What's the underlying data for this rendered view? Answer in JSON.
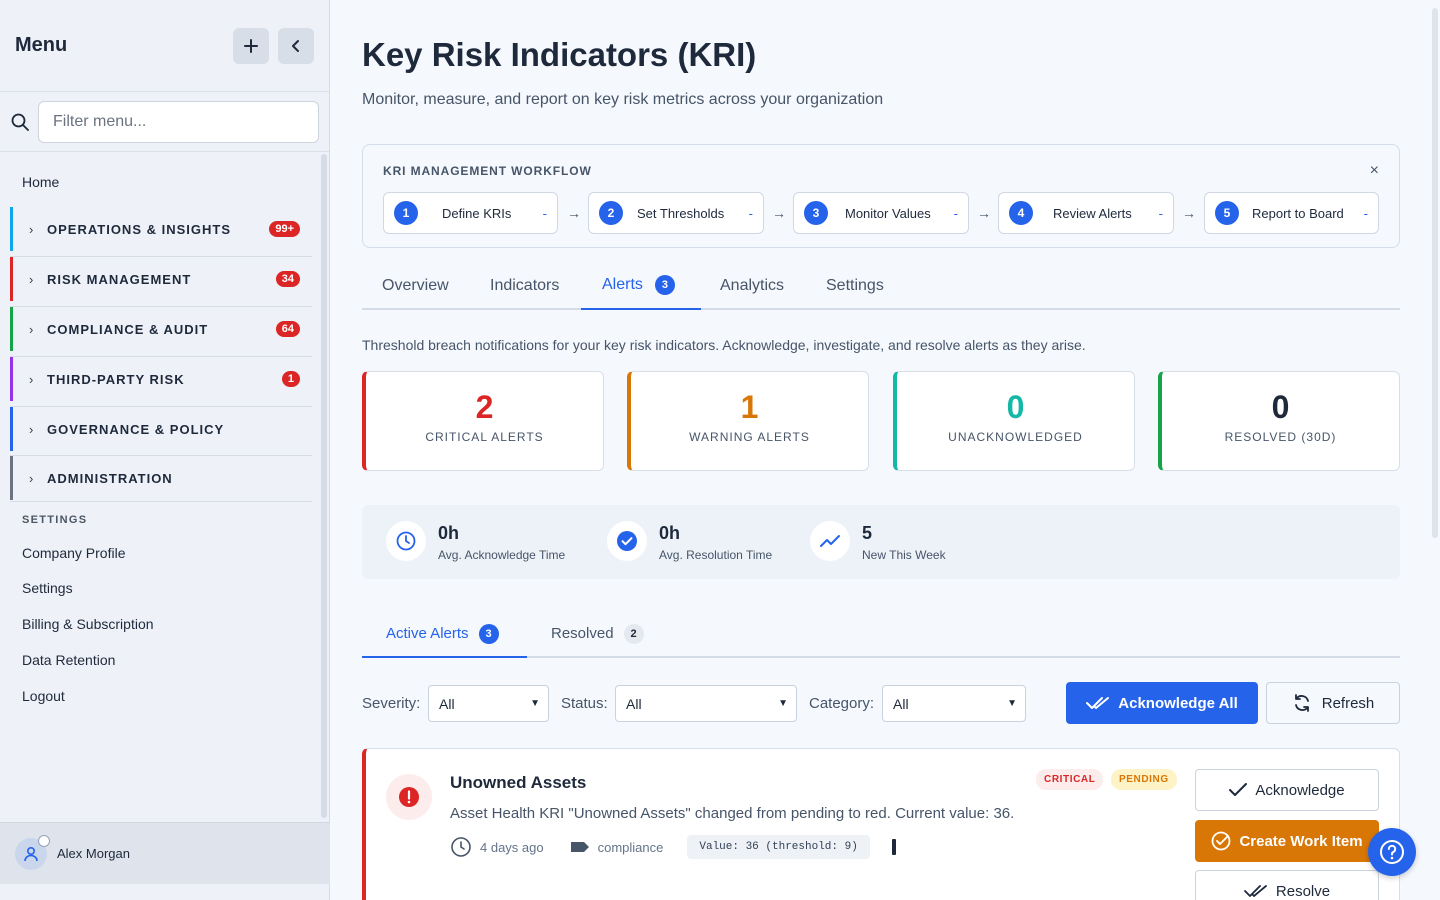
{
  "sidebar": {
    "title": "Menu",
    "filter_placeholder": "Filter menu...",
    "home": "Home",
    "groups": [
      {
        "label": "OPERATIONS & INSIGHTS",
        "badge": "99+",
        "color": "#0ea5e9"
      },
      {
        "label": "RISK MANAGEMENT",
        "badge": "34",
        "color": "#dc2626"
      },
      {
        "label": "COMPLIANCE & AUDIT",
        "badge": "64",
        "color": "#16a34a"
      },
      {
        "label": "THIRD-PARTY RISK",
        "badge": "1",
        "color": "#9333ea"
      },
      {
        "label": "GOVERNANCE & POLICY",
        "badge": "",
        "color": "#2563eb"
      },
      {
        "label": "ADMINISTRATION",
        "badge": "",
        "color": "#6b7280"
      }
    ],
    "settings_section": "SETTINGS",
    "links": [
      "Company Profile",
      "Settings",
      "Billing & Subscription",
      "Data Retention",
      "Logout"
    ],
    "user_name": "Alex Morgan"
  },
  "header": {
    "title": "Key Risk Indicators (KRI)",
    "subtitle": "Monitor, measure, and report on key risk metrics across your organization"
  },
  "workflow": {
    "title": "KRI MANAGEMENT WORKFLOW",
    "close": "×",
    "steps": [
      {
        "num": "1",
        "label": "Define KRIs",
        "status": "-"
      },
      {
        "num": "2",
        "label": "Set Thresholds",
        "status": "-"
      },
      {
        "num": "3",
        "label": "Monitor Values",
        "status": "-"
      },
      {
        "num": "4",
        "label": "Review Alerts",
        "status": "-"
      },
      {
        "num": "5",
        "label": "Report to Board",
        "status": "-"
      }
    ],
    "arrow": "→"
  },
  "tabs": {
    "overview": "Overview",
    "indicators": "Indicators",
    "alerts": "Alerts",
    "alerts_count": "3",
    "analytics": "Analytics",
    "settings": "Settings"
  },
  "alerts_description": "Threshold breach notifications for your key risk indicators. Acknowledge, investigate, and resolve alerts as they arise.",
  "stats": [
    {
      "value": "2",
      "label": "CRITICAL ALERTS",
      "color": "#dc2626"
    },
    {
      "value": "1",
      "label": "WARNING ALERTS",
      "color": "#d97706"
    },
    {
      "value": "0",
      "label": "UNACKNOWLEDGED",
      "color": "#14b8a6"
    },
    {
      "value": "0",
      "label": "RESOLVED (30D)",
      "color": "#1e293b"
    }
  ],
  "metrics": [
    {
      "value": "0h",
      "label": "Avg. Acknowledge Time",
      "icon": "clock-icon"
    },
    {
      "value": "0h",
      "label": "Avg. Resolution Time",
      "icon": "check-circle-icon"
    },
    {
      "value": "5",
      "label": "New This Week",
      "icon": "trend-icon"
    }
  ],
  "subtabs": {
    "active": "Active Alerts",
    "active_count": "3",
    "resolved": "Resolved",
    "resolved_count": "2"
  },
  "filters": {
    "severity_label": "Severity:",
    "severity_value": "All",
    "status_label": "Status:",
    "status_value": "All",
    "category_label": "Category:",
    "category_value": "All",
    "acknowledge_all": "Acknowledge All",
    "refresh": "Refresh"
  },
  "alert": {
    "title": "Unowned Assets",
    "severity": "CRITICAL",
    "status": "PENDING",
    "message": "Asset Health KRI \"Unowned Assets\" changed from pending to red. Current value: 36.",
    "time": "4 days ago",
    "category": "compliance",
    "value_text": "Value: 36 (threshold: 9)",
    "acknowledge": "Acknowledge",
    "create_work_item": "Create Work Item",
    "resolve": "Resolve"
  },
  "colors": {
    "primary": "#2563eb",
    "critical": "#dc2626",
    "warning": "#d97706"
  }
}
